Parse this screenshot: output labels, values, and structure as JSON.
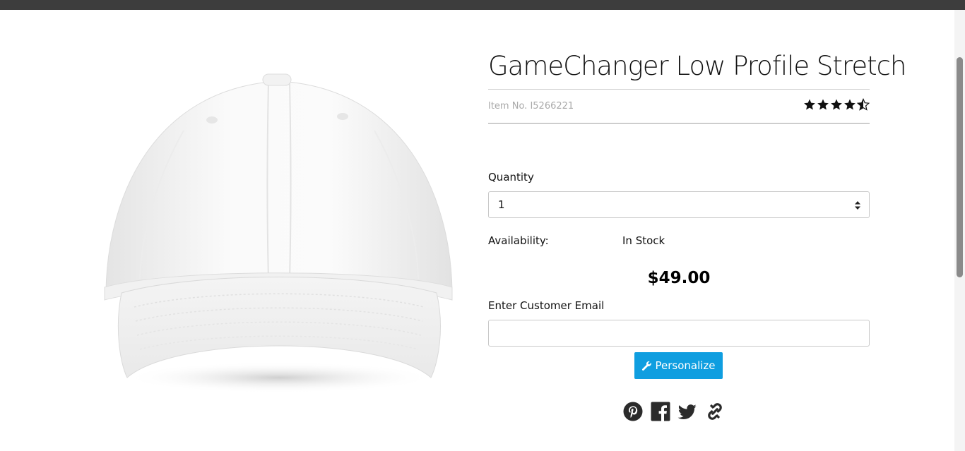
{
  "product": {
    "title": "GameChanger Low Profile Stretch",
    "item_number": "Item No. I5266221",
    "rating": 4.5,
    "image_icon": "white-baseball-cap",
    "quantity_label": "Quantity",
    "quantity_value": "1",
    "availability_label": "Availability:",
    "availability_value": "In Stock",
    "price": "$49.00",
    "email_label": "Enter Customer Email",
    "email_value": "",
    "personalize_button": "Personalize"
  },
  "share": {
    "icons": [
      "pinterest-icon",
      "facebook-icon",
      "twitter-icon",
      "link-icon"
    ]
  },
  "colors": {
    "accent": "#0f9ee0",
    "topbar": "#3d3d3d",
    "muted_text": "#a9a9a9"
  }
}
